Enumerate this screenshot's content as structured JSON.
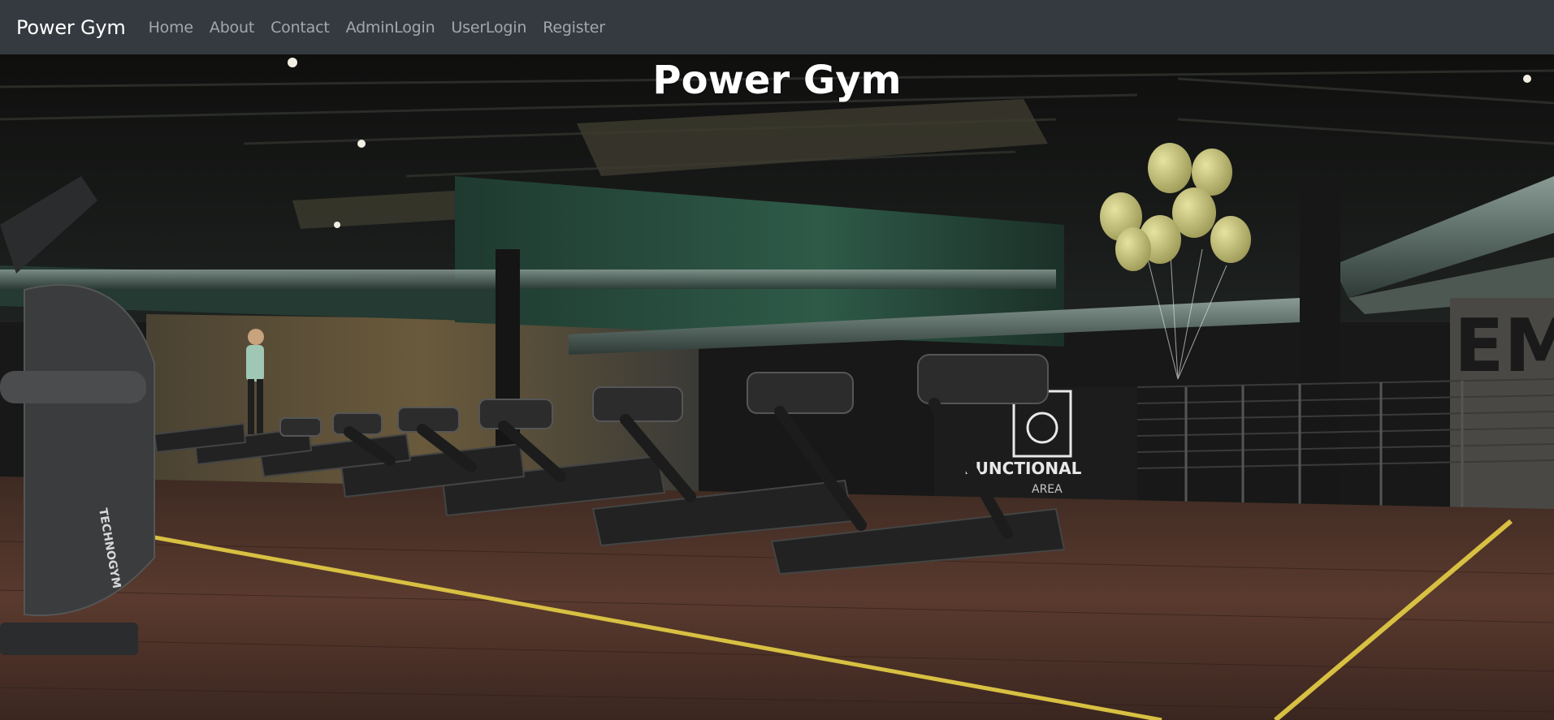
{
  "navbar": {
    "brand": "Power Gym",
    "links": [
      "Home",
      "About",
      "Contact",
      "AdminLogin",
      "UserLogin",
      "Register"
    ]
  },
  "hero": {
    "title": "Power Gym",
    "image_alt": "gym-interior-photo",
    "wall_signage": "FUNCTIONAL AREA",
    "equipment_brand": "TECHNOGYM"
  },
  "colors": {
    "navbar_bg": "#343a40",
    "brand_text": "#ffffff",
    "nav_link_text": "rgba(255,255,255,0.55)",
    "floor_line": "#e0c84a",
    "balloon": "#c8c47a"
  }
}
